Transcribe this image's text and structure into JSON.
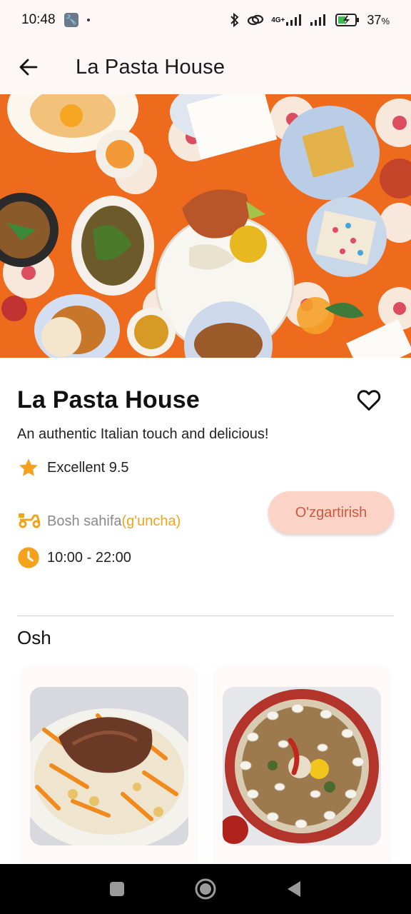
{
  "status_bar": {
    "time": "10:48",
    "network": "4G+",
    "battery": "37",
    "battery_unit": "%"
  },
  "app_bar": {
    "title": "La Pasta House",
    "back_icon": "arrow-left-icon"
  },
  "restaurant": {
    "name": "La Pasta House",
    "tagline": "An authentic Italian touch and delicious!",
    "rating_text": "Excellent 9.5",
    "delivery_label": "Bosh sahifa",
    "delivery_accent": "(g'uncha)",
    "change_button": "O'zgartirish",
    "hours": "10:00 - 22:00"
  },
  "menu": {
    "section_title": "Osh",
    "items": [
      {
        "image": "osh-plov-with-carrots-photo"
      },
      {
        "image": "osh-plov-with-quail-eggs-photo"
      }
    ]
  },
  "colors": {
    "accent": "#f0a41c",
    "button_bg": "#fcd3c7",
    "button_text": "#d0583c",
    "header_bg": "#fdf8f5"
  }
}
